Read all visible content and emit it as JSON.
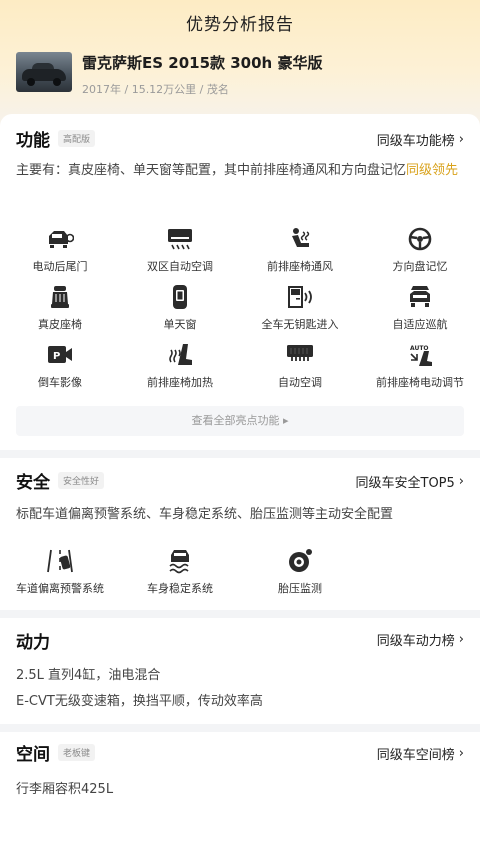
{
  "page": {
    "title": "优势分析报告"
  },
  "car": {
    "name": "雷克萨斯ES 2015款 300h 豪华版",
    "meta": "2017年 / 15.12万公里 / 茂名"
  },
  "function": {
    "title": "功能",
    "tag": "高配版",
    "link": "同级车功能榜",
    "desc_main": "主要有：真皮座椅、单天窗等配置，其中前排座椅通风和方向盘记忆",
    "desc_highlight": "同级领先",
    "features": [
      {
        "label": "电动后尾门",
        "icon": "power-tailgate-icon"
      },
      {
        "label": "双区自动空调",
        "icon": "dual-zone-ac-icon"
      },
      {
        "label": "前排座椅通风",
        "icon": "seat-ventilation-icon"
      },
      {
        "label": "方向盘记忆",
        "icon": "steering-memory-icon"
      },
      {
        "label": "真皮座椅",
        "icon": "leather-seat-icon"
      },
      {
        "label": "单天窗",
        "icon": "sunroof-icon"
      },
      {
        "label": "全车无钥匙进入",
        "icon": "keyless-entry-icon"
      },
      {
        "label": "自适应巡航",
        "icon": "adaptive-cruise-icon"
      },
      {
        "label": "倒车影像",
        "icon": "reverse-camera-icon"
      },
      {
        "label": "前排座椅加热",
        "icon": "seat-heating-icon"
      },
      {
        "label": "自动空调",
        "icon": "auto-ac-icon"
      },
      {
        "label": "前排座椅电动调节",
        "icon": "power-seat-icon"
      }
    ],
    "view_all": "查看全部亮点功能 ▸"
  },
  "safety": {
    "title": "安全",
    "tag": "安全性好",
    "link": "同级车安全TOP5",
    "desc": "标配车道偏离预警系统、车身稳定系统、胎压监测等主动安全配置",
    "features": [
      {
        "label": "车道偏离预警系统",
        "icon": "lane-departure-icon"
      },
      {
        "label": "车身稳定系统",
        "icon": "stability-control-icon"
      },
      {
        "label": "胎压监测",
        "icon": "tire-pressure-icon"
      }
    ]
  },
  "power": {
    "title": "动力",
    "link": "同级车动力榜",
    "line1": "2.5L 直列4缸，油电混合",
    "line2": "E-CVT无级变速箱，换挡平顺，传动效率高"
  },
  "space": {
    "title": "空间",
    "tag": "老板键",
    "link": "同级车空间榜",
    "line1": "行李厢容积425L"
  },
  "colors": {
    "accent": "#d9a21b",
    "header_bg": "#fdecc4",
    "icon": "#2b2b2b"
  }
}
